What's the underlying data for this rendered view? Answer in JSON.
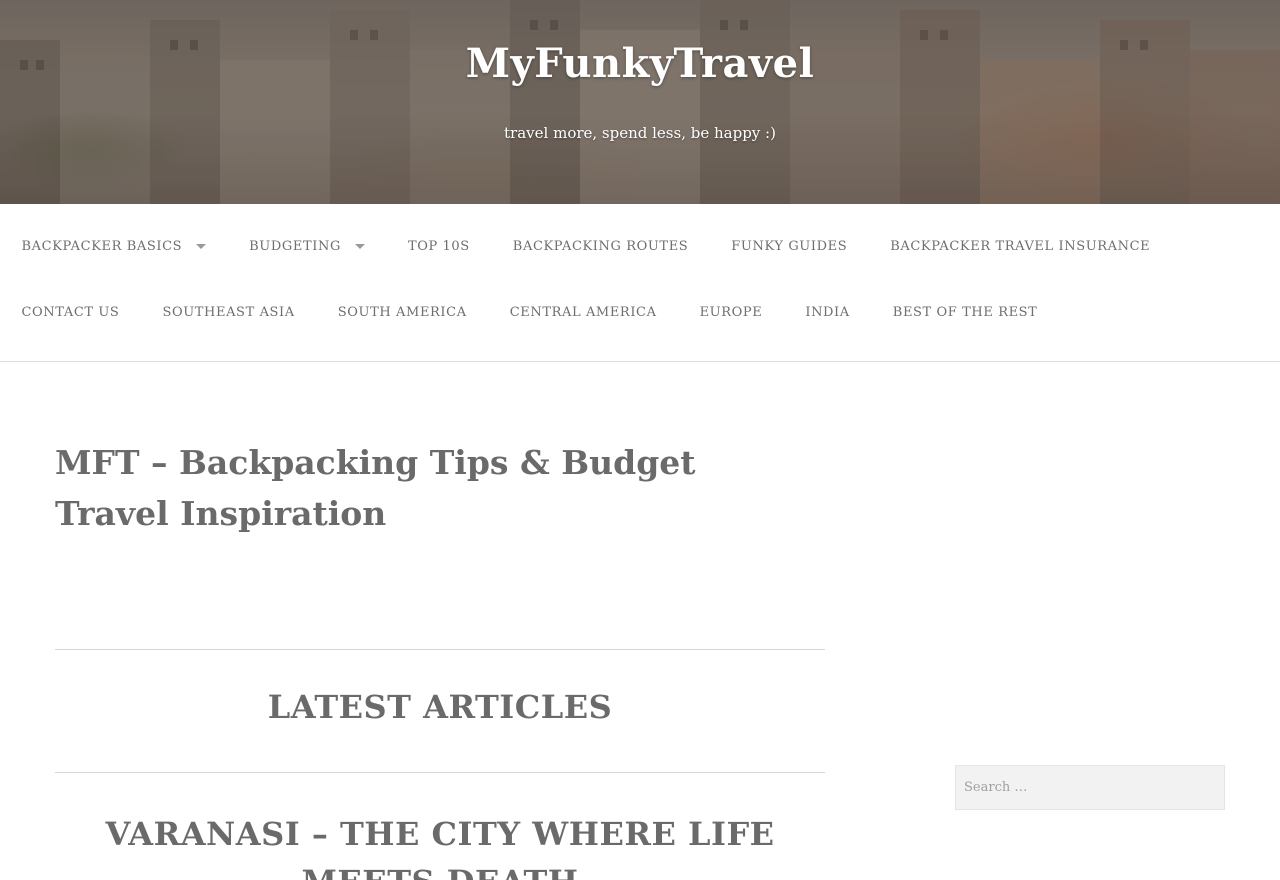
{
  "header": {
    "site_title": "MyFunkyTravel",
    "tagline": "travel more, spend less, be happy :)"
  },
  "nav": {
    "row1": [
      {
        "label": "BACKPACKER BASICS",
        "has_dropdown": true
      },
      {
        "label": "BUDGETING",
        "has_dropdown": true
      },
      {
        "label": "TOP 10S",
        "has_dropdown": false
      },
      {
        "label": "BACKPACKING ROUTES",
        "has_dropdown": false
      },
      {
        "label": "FUNKY GUIDES",
        "has_dropdown": false
      },
      {
        "label": "BACKPACKER TRAVEL INSURANCE",
        "has_dropdown": false
      }
    ],
    "row2": [
      {
        "label": "CONTACT US"
      },
      {
        "label": "SOUTHEAST ASIA"
      },
      {
        "label": "SOUTH AMERICA"
      },
      {
        "label": "CENTRAL AMERICA"
      },
      {
        "label": "EUROPE"
      },
      {
        "label": "INDIA"
      },
      {
        "label": "BEST OF THE REST"
      }
    ]
  },
  "main": {
    "page_heading": "MFT – Backpacking Tips & Budget Travel Inspiration",
    "section_title": "LATEST ARTICLES",
    "article_title": "VARANASI – THE CITY WHERE LIFE MEETS DEATH"
  },
  "sidebar": {
    "search_placeholder": "Search …"
  },
  "colors": {
    "text": "#6a6a6a",
    "nav_text": "#6e6e6e",
    "header_text": "#ffffff"
  }
}
